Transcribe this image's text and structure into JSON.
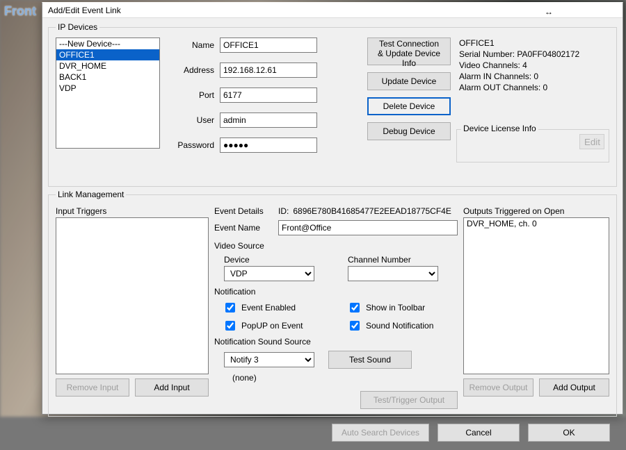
{
  "backdrop_tab": "Front",
  "dialog": {
    "title": "Add/Edit Event Link",
    "resize_glyph": "↔"
  },
  "ip_devices": {
    "legend": "IP Devices",
    "list": [
      "---New Device---",
      "OFFICE1",
      "DVR_HOME",
      "BACK1",
      "VDP"
    ],
    "selected_index": 1,
    "fields": {
      "name": {
        "label": "Name",
        "value": "OFFICE1"
      },
      "address": {
        "label": "Address",
        "value": "192.168.12.61"
      },
      "port": {
        "label": "Port",
        "value": "6177"
      },
      "user": {
        "label": "User",
        "value": "admin"
      },
      "password": {
        "label": "Password",
        "value": "●●●●●"
      }
    },
    "buttons": {
      "test": "Test Connection\n& Update Device Info",
      "update": "Update Device",
      "delete": "Delete Device",
      "debug": "Debug Device"
    },
    "info_title": "OFFICE1",
    "info_lines": [
      "Serial Number: PA0FF04802172",
      "Video Channels: 4",
      "Alarm IN Channels: 0",
      "Alarm OUT Channels: 0"
    ],
    "license": {
      "legend": "Device License Info",
      "edit": "Edit"
    }
  },
  "link_mgmt": {
    "legend": "Link Management",
    "input_triggers_label": "Input Triggers",
    "input_triggers": [],
    "remove_input": "Remove Input",
    "add_input": "Add Input",
    "event_details_label": "Event Details",
    "event_id_label": "ID:",
    "event_id": "6896E780B41685477E2EEAD18775CF4E",
    "event_name_label": "Event Name",
    "event_name": "Front@Office",
    "video_source_label": "Video Source",
    "vs_device_label": "Device",
    "vs_device": "VDP",
    "vs_channel_label": "Channel Number",
    "vs_channel": "",
    "notification_label": "Notification",
    "checks": {
      "event_enabled": "Event Enabled",
      "show_toolbar": "Show in Toolbar",
      "popup": "PopUP on Event",
      "sound": "Sound Notification"
    },
    "notif_src_label": "Notification Sound Source",
    "notif_src": "Notify 3",
    "test_sound": "Test Sound",
    "none_label": "(none)",
    "test_trigger": "Test/Trigger Output",
    "outputs_label": "Outputs Triggered on Open",
    "outputs": [
      "DVR_HOME, ch. 0"
    ],
    "remove_output": "Remove Output",
    "add_output": "Add Output"
  },
  "buttons": {
    "auto_search": "Auto Search Devices",
    "cancel": "Cancel",
    "ok": "OK"
  }
}
